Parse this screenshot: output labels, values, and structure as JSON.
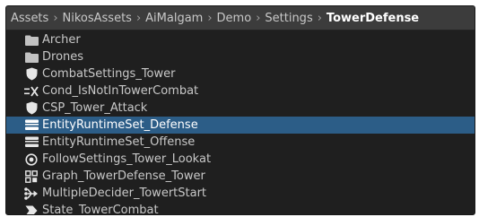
{
  "breadcrumb": {
    "items": [
      "Assets",
      "NikosAssets",
      "AiMalgam",
      "Demo",
      "Settings",
      "TowerDefense"
    ]
  },
  "assets": [
    {
      "label": "Archer",
      "icon": "folder-icon"
    },
    {
      "label": "Drones",
      "icon": "folder-icon"
    },
    {
      "label": "CombatSettings_Tower",
      "icon": "shield-icon"
    },
    {
      "label": "Cond_IsNotInTowerCombat",
      "icon": "condition-icon"
    },
    {
      "label": "CSP_Tower_Attack",
      "icon": "shield-icon"
    },
    {
      "label": "EntityRuntimeSet_Defense",
      "icon": "runtime-set-icon",
      "selected": true
    },
    {
      "label": "EntityRuntimeSet_Offense",
      "icon": "runtime-set-icon"
    },
    {
      "label": "FollowSettings_Tower_Lookat",
      "icon": "target-icon"
    },
    {
      "label": "Graph_TowerDefense_Tower",
      "icon": "graph-icon"
    },
    {
      "label": "MultipleDecider_TowertStart",
      "icon": "decider-icon"
    },
    {
      "label": "State_TowerCombat",
      "icon": "state-icon"
    }
  ],
  "colors": {
    "panel_bg": "#1f1f1f",
    "breadcrumb_bg": "#3c3c3c",
    "selection": "#2c5d87",
    "text": "#c8c8c8"
  }
}
